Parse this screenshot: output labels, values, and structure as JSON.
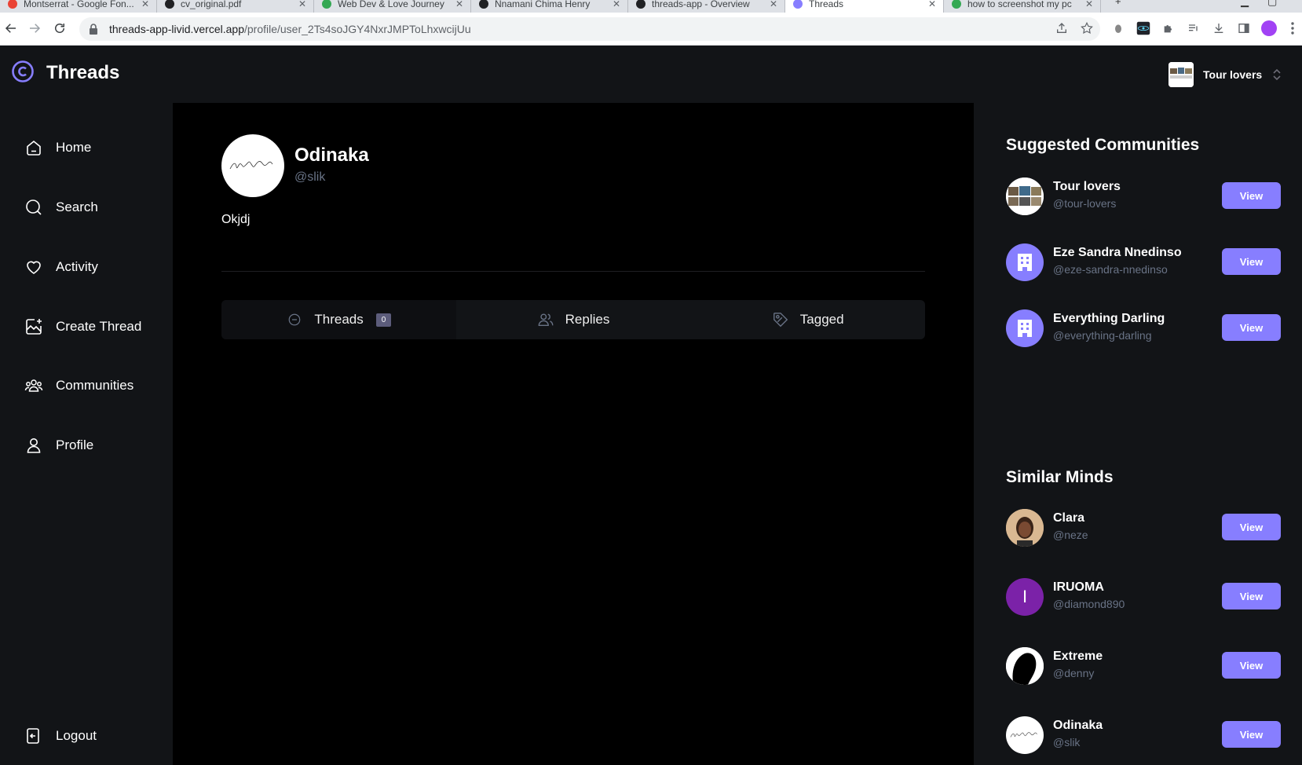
{
  "browser": {
    "tabs": [
      {
        "title": "Montserrat - Google Fon..."
      },
      {
        "title": "cv_original.pdf"
      },
      {
        "title": "Web Dev & Love Journey"
      },
      {
        "title": "Nnamani Chima Henry"
      },
      {
        "title": "threads-app - Overview"
      },
      {
        "title": "Threads"
      },
      {
        "title": "how to screenshot my pc"
      }
    ],
    "url_host": "threads-app-livid.vercel.app",
    "url_path": "/profile/user_2Ts4soJGY4NxrJMPToLhxwcijUu"
  },
  "app": {
    "brand": "Threads",
    "org_switcher": {
      "name": "Tour lovers"
    }
  },
  "leftbar": {
    "items": [
      {
        "label": "Home",
        "icon": "home-icon"
      },
      {
        "label": "Search",
        "icon": "search-icon"
      },
      {
        "label": "Activity",
        "icon": "heart-icon"
      },
      {
        "label": "Create Thread",
        "icon": "create-thread-icon"
      },
      {
        "label": "Communities",
        "icon": "communities-icon"
      },
      {
        "label": "Profile",
        "icon": "user-icon"
      }
    ],
    "logout": "Logout"
  },
  "profile": {
    "name": "Odinaka",
    "username": "@slik",
    "bio": "Okjdj",
    "tabs": [
      {
        "label": "Threads",
        "count": "0",
        "icon": "chat-bubble-icon"
      },
      {
        "label": "Replies",
        "icon": "members-icon"
      },
      {
        "label": "Tagged",
        "icon": "tag-icon"
      }
    ]
  },
  "rightbar": {
    "suggested_title": "Suggested Communities",
    "communities": [
      {
        "name": "Tour lovers",
        "handle": "@tour-lovers",
        "button": "View"
      },
      {
        "name": "Eze Sandra Nnedinso",
        "handle": "@eze-sandra-nnedinso",
        "button": "View"
      },
      {
        "name": "Everything Darling",
        "handle": "@everything-darling",
        "button": "View"
      }
    ],
    "similar_title": "Similar Minds",
    "users": [
      {
        "name": "Clara",
        "handle": "@neze",
        "button": "View"
      },
      {
        "name": "IRUOMA",
        "handle": "@diamond890",
        "button": "View",
        "initial": "I"
      },
      {
        "name": "Extreme",
        "handle": "@denny",
        "button": "View"
      },
      {
        "name": "Odinaka",
        "handle": "@slik",
        "button": "View"
      }
    ]
  },
  "colors": {
    "primary": "#877eff",
    "background": "#000000",
    "panel": "#121417",
    "muted_text": "#697386"
  }
}
